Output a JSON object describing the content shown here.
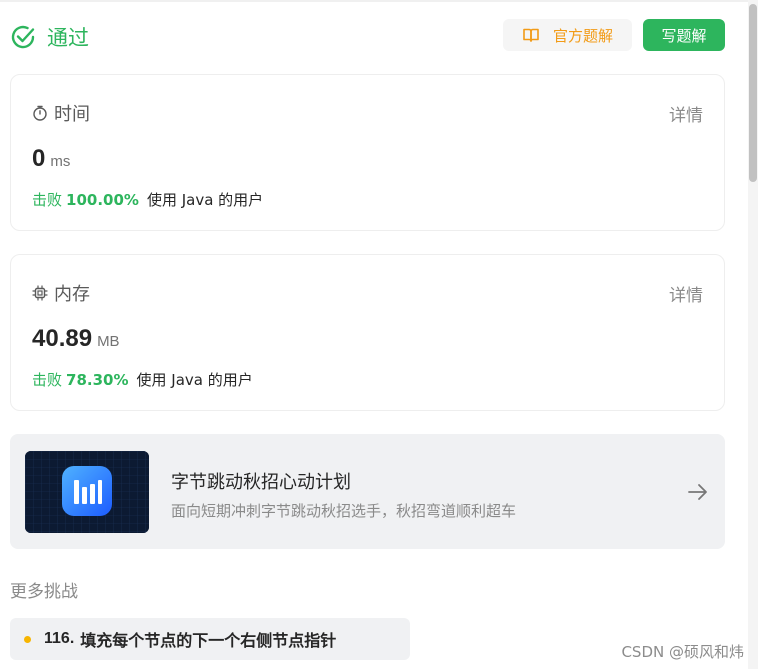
{
  "header": {
    "status": "通过",
    "official_solution_label": "官方题解",
    "write_solution_label": "写题解"
  },
  "time_card": {
    "title": "时间",
    "details_label": "详情",
    "value": "0",
    "unit": "ms",
    "beat_prefix": "击败",
    "beat_percent": "100.00%",
    "beat_suffix": "使用 Java 的用户"
  },
  "memory_card": {
    "title": "内存",
    "details_label": "详情",
    "value": "40.89",
    "unit": "MB",
    "beat_prefix": "击败",
    "beat_percent": "78.30%",
    "beat_suffix": "使用 Java 的用户"
  },
  "banner": {
    "title": "字节跳动秋招心动计划",
    "subtitle": "面向短期冲刺字节跳动秋招选手，秋招弯道顺利超车"
  },
  "more_challenges": {
    "heading": "更多挑战",
    "items": [
      {
        "number": "116.",
        "title": "填充每个节点的下一个右侧节点指针"
      }
    ]
  },
  "watermark": "CSDN @硕风和炜",
  "colors": {
    "accent_green": "#2db55d",
    "official_orange": "#f29b16",
    "dot_yellow": "#f7b500"
  }
}
